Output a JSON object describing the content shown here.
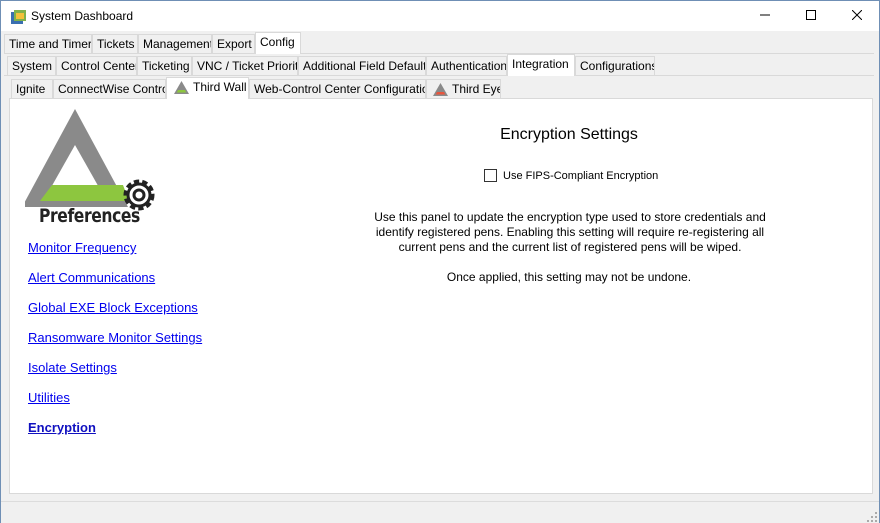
{
  "window": {
    "title": "System Dashboard",
    "minimize_icon": "minimize-icon",
    "maximize_icon": "maximize-icon",
    "close_icon": "close-icon"
  },
  "tabs_level1": [
    "Time and Timers",
    "Tickets",
    "Management",
    "Export",
    "Config"
  ],
  "tabs_level1_active": "Config",
  "tabs_level2": [
    "System",
    "Control Center",
    "Ticketing",
    "VNC / Ticket Priority",
    "Additional Field Defaults",
    "Authentication",
    "Integration",
    "Configurations"
  ],
  "tabs_level2_active": "Integration",
  "tabs_level3": [
    "Ignite",
    "ConnectWise Control",
    "Third Wall",
    "Web-Control Center Configuration",
    "Third Eye"
  ],
  "tabs_level3_active": "Third Wall",
  "sidebar": {
    "logo_text": "Preferences",
    "links": [
      "Monitor Frequency",
      "Alert Communications",
      "Global EXE Block Exceptions",
      "Ransomware Monitor Settings",
      "Isolate Settings",
      "Utilities",
      "Encryption"
    ],
    "active_link": "Encryption"
  },
  "content": {
    "heading": "Encryption Settings",
    "checkbox_label": "Use FIPS-Compliant Encryption",
    "checkbox_checked": false,
    "description": "Use this panel to update the encryption type used to store credentials and identify registered pens.  Enabling this setting will require re-registering all current pens and the current list of registered pens will be wiped.",
    "note": "Once applied, this setting may not be undone."
  },
  "colors": {
    "accent_green": "#8dc63f",
    "logo_gray": "#8a8a8a",
    "link_blue": "#0000ee",
    "eye_orange": "#e8553d"
  }
}
